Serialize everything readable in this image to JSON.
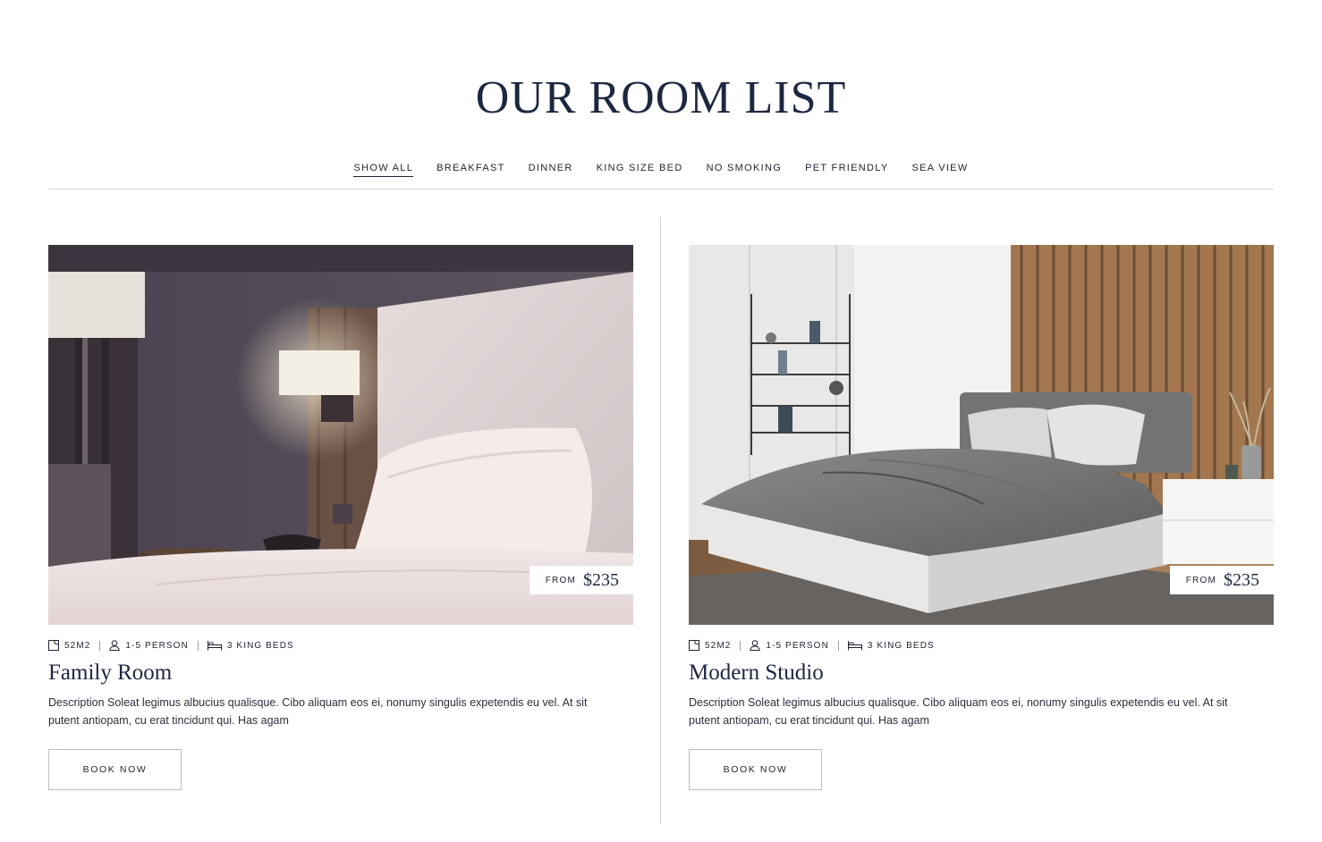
{
  "page": {
    "title": "OUR ROOM LIST"
  },
  "filters": [
    {
      "label": "SHOW ALL",
      "active": true
    },
    {
      "label": "BREAKFAST",
      "active": false
    },
    {
      "label": "DINNER",
      "active": false
    },
    {
      "label": "KING SIZE BED",
      "active": false
    },
    {
      "label": "NO SMOKING",
      "active": false
    },
    {
      "label": "PET FRIENDLY",
      "active": false
    },
    {
      "label": "SEA VIEW",
      "active": false
    }
  ],
  "rooms": [
    {
      "name": "Family Room",
      "price_from_label": "FROM",
      "price": "$235",
      "size": "52M2",
      "persons": "1-5 PERSON",
      "beds": "3 KING BEDS",
      "description": "Description Soleat legimus albucius qualisque. Cibo aliquam eos ei, nonumy singulis expetendis eu vel. At sit putent antiopam, cu erat tincidunt qui. Has agam",
      "button_label": "BOOK NOW"
    },
    {
      "name": "Modern Studio",
      "price_from_label": "FROM",
      "price": "$235",
      "size": "52M2",
      "persons": "1-5 PERSON",
      "beds": "3 KING BEDS",
      "description": "Description Soleat legimus albucius qualisque. Cibo aliquam eos ei, nonumy singulis expetendis eu vel. At sit putent antiopam, cu erat tincidunt qui. Has agam",
      "button_label": "BOOK NOW"
    }
  ],
  "icons": {
    "size": "room-size-icon",
    "persons": "person-icon",
    "beds": "bed-icon"
  },
  "colors": {
    "heading": "#1d2740",
    "text": "#1d2433",
    "divider": "#d4d6da"
  }
}
